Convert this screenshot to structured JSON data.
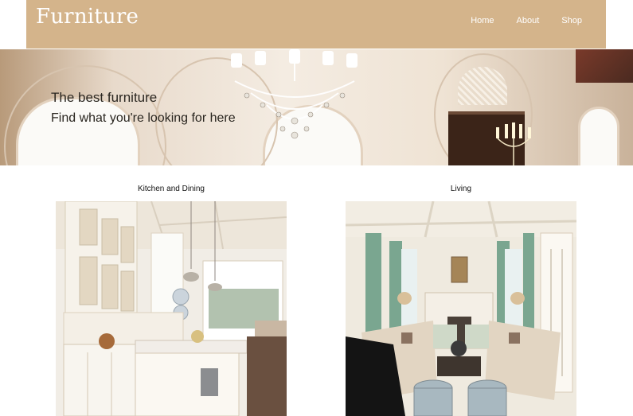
{
  "header": {
    "logo": "Furniture",
    "nav": [
      "Home",
      "About",
      "Shop"
    ]
  },
  "hero": {
    "title": "The best furniture",
    "subtitle": "Find what you're looking for here"
  },
  "categories": [
    {
      "label": "Kitchen and Dining"
    },
    {
      "label": "Living"
    }
  ],
  "colors": {
    "header_bg": "#d4b48b",
    "header_text": "#ffffff",
    "hero_text": "#2a2620"
  }
}
